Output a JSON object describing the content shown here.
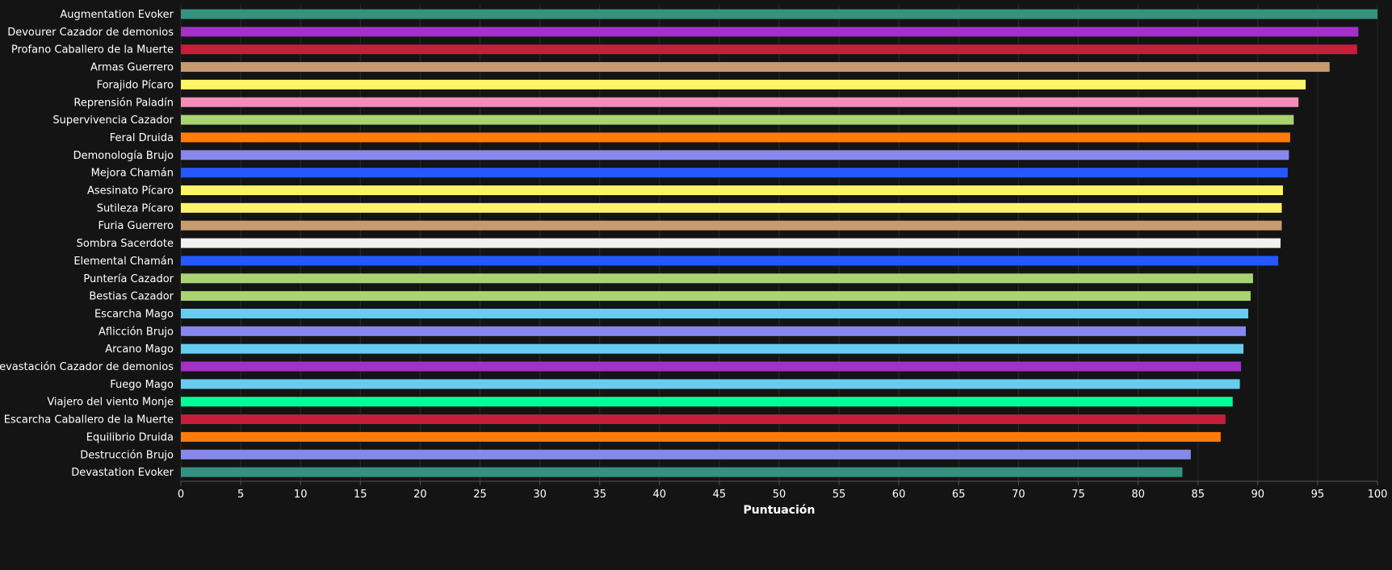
{
  "chart_data": {
    "type": "bar",
    "orientation": "horizontal",
    "xlabel": "Puntuación",
    "xlim": [
      0,
      100
    ],
    "xticks": [
      0,
      5,
      10,
      15,
      20,
      25,
      30,
      35,
      40,
      45,
      50,
      55,
      60,
      65,
      70,
      75,
      80,
      85,
      90,
      95,
      100
    ],
    "grid": true,
    "categories": [
      "Augmentation Evoker",
      "Devourer Cazador de demonios",
      "Profano Caballero de la Muerte",
      "Armas Guerrero",
      "Forajido Pícaro",
      "Reprensión Paladín",
      "Supervivencia Cazador",
      "Feral Druida",
      "Demonología Brujo",
      "Mejora Chamán",
      "Asesinato Pícaro",
      "Sutileza Pícaro",
      "Furia Guerrero",
      "Sombra Sacerdote",
      "Elemental Chamán",
      "Puntería Cazador",
      "Bestias Cazador",
      "Escarcha Mago",
      "Aflicción Brujo",
      "Arcano Mago",
      "Devastación Cazador de demonios",
      "Fuego Mago",
      "Viajero del viento Monje",
      "Escarcha Caballero de la Muerte",
      "Equilibrio Druida",
      "Destrucción Brujo",
      "Devastation Evoker"
    ],
    "values": [
      100.0,
      98.4,
      98.3,
      96.0,
      94.0,
      93.4,
      93.0,
      92.7,
      92.6,
      92.5,
      92.1,
      92.0,
      92.0,
      91.9,
      91.7,
      89.6,
      89.4,
      89.2,
      89.0,
      88.8,
      88.6,
      88.5,
      87.9,
      87.3,
      86.9,
      84.4,
      83.7
    ],
    "colors": [
      "#33937F",
      "#A330C9",
      "#C41E3A",
      "#C69B6D",
      "#FFF468",
      "#F48CBA",
      "#AAD372",
      "#FF7C0A",
      "#8788EE",
      "#2359FF",
      "#FFF468",
      "#FFF468",
      "#C69B6D",
      "#F0F0F0",
      "#2359FF",
      "#AAD372",
      "#AAD372",
      "#68CCEF",
      "#8788EE",
      "#68CCEF",
      "#A330C9",
      "#68CCEF",
      "#00FF98",
      "#C41E3A",
      "#FF7C0A",
      "#8788EE",
      "#33937F"
    ]
  }
}
